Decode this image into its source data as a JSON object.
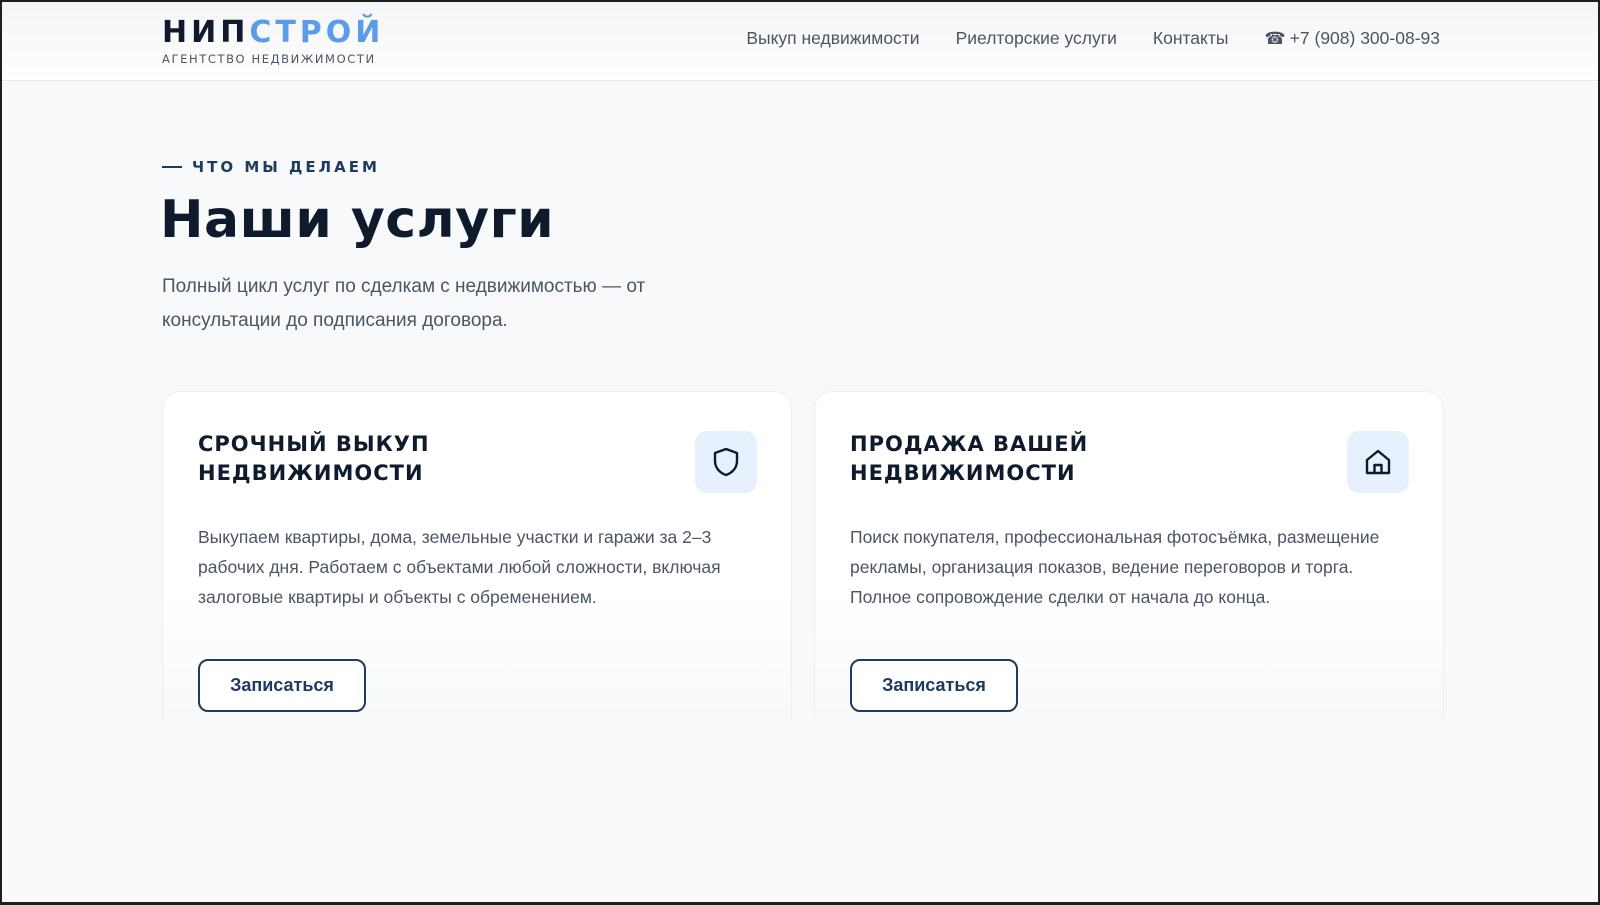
{
  "header": {
    "logo": {
      "part1": "НИП",
      "part2": "СТРОЙ",
      "tagline": "АГЕНТСТВО НЕДВИЖИМОСТИ"
    },
    "nav": [
      {
        "label": "Выкуп недвижимости"
      },
      {
        "label": "Риелторские услуги"
      },
      {
        "label": "Контакты"
      }
    ],
    "phone": {
      "icon": "phone-icon",
      "glyph": "☎",
      "number": "+7 (908) 300-08-93"
    }
  },
  "section": {
    "eyebrow": "ЧТО МЫ ДЕЛАЕМ",
    "title": "Наши услуги",
    "subtitle": "Полный цикл услуг по сделкам с недвижимостью — от консультации до подписания договора."
  },
  "cards": [
    {
      "title": "СРОЧНЫЙ ВЫКУП НЕДВИЖИМОСТИ",
      "icon": "shield-icon",
      "description": "Выкупаем квартиры, дома, земельные участки и гаражи за 2–3 рабочих дня. Работаем с объектами любой сложности, включая залоговые квартиры и объекты с обременением.",
      "button": "Записаться"
    },
    {
      "title": "ПРОДАЖА ВАШЕЙ НЕДВИЖИМОСТИ",
      "icon": "house-icon",
      "description": "Поиск покупателя, профессиональная фотосъёмка, размещение рекламы, организация показов, ведение переговоров и торга. Полное сопровождение сделки от начала до конца.",
      "button": "Записаться"
    }
  ],
  "colors": {
    "accent": "#5b9bea",
    "dark": "#0f1b2d",
    "navy": "#1e3a5f",
    "icon_bg": "#e6f1fd"
  }
}
